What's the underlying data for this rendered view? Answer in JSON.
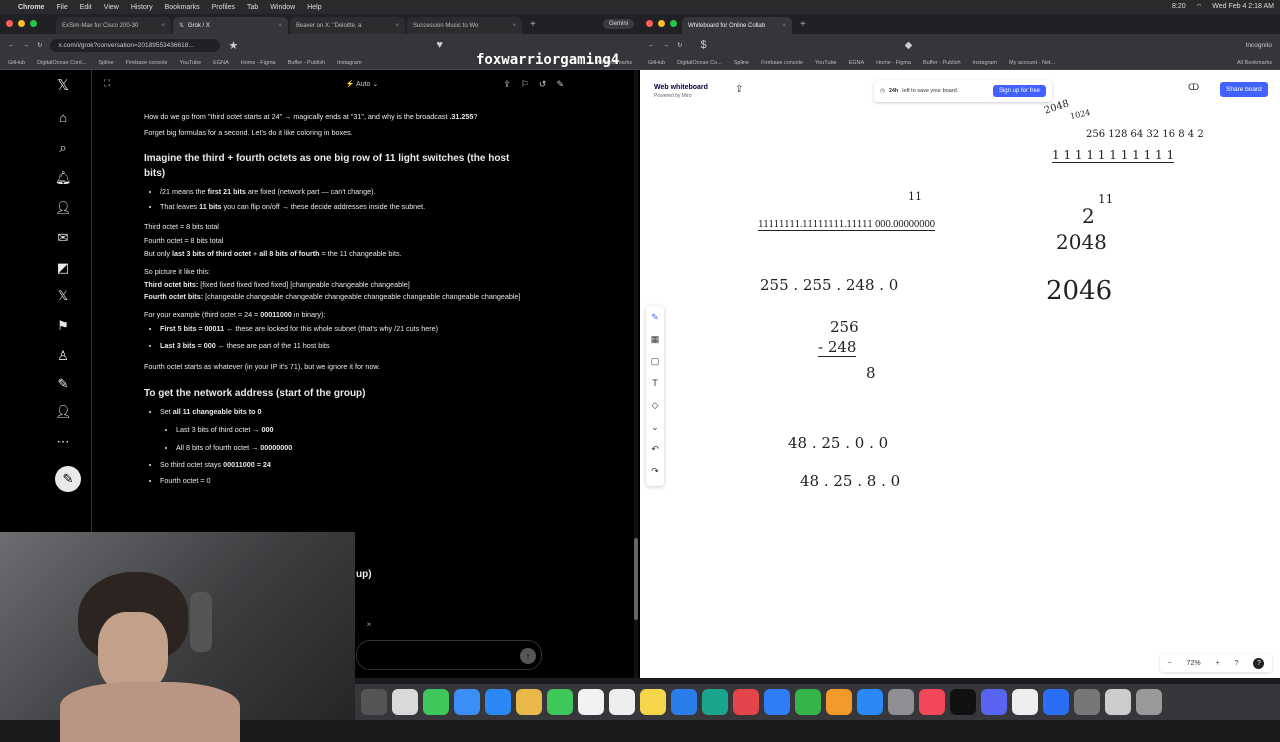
{
  "menubar": {
    "app": "Chrome",
    "items": [
      "File",
      "Edit",
      "View",
      "History",
      "Bookmarks",
      "Profiles",
      "Tab",
      "Window",
      "Help"
    ],
    "clock": "Wed Feb 4  2:18 AM",
    "extra": "8:20"
  },
  "left_window": {
    "tabs": [
      {
        "label": "ExSim-Max for Cisco 200-30"
      },
      {
        "label": "Grok / X"
      },
      {
        "label": "Beaver on X: \"Deloitte, a"
      },
      {
        "label": "Succession Music to Wo"
      }
    ],
    "gemini": "Gemini",
    "url": "x.com/i/grok?conversation=20189553436618...",
    "overlay_name": "foxwarriorgaming4",
    "bookmarks": [
      "GitHub",
      "DigitalOcean Cont...",
      "Spline",
      "Firebase console",
      "YouTube",
      "EGNA",
      "Home - Figma",
      "Buffer - Publish",
      "Instagram"
    ],
    "all_bookmarks": "All Bookmarks",
    "mode": "Auto"
  },
  "right_window": {
    "tabs": [
      {
        "label": "Whiteboard for Online Collab"
      }
    ],
    "incognito": "Incognito",
    "bookmarks": [
      "GitHub",
      "DigitalOcean Co...",
      "Spline",
      "Firebase console",
      "YouTube",
      "EGNA",
      "Home - Figma",
      "Buffer - Publish",
      "Instagram",
      "My account - Net..."
    ],
    "all_bookmarks": "All Bookmarks",
    "board_title": "Web whiteboard",
    "board_sub": "Powered by Miro",
    "banner_text_bold": "24h",
    "banner_text": "left to save your board.",
    "signup": "Sign up for free",
    "share": "Share board",
    "zoom": "72%"
  },
  "chat": {
    "intro1_a": "How do we go from \"third octet starts at 24\" → magically ends at \"31\", and why is the broadcast ",
    "intro1_b": ".31.255",
    "intro1_c": "?",
    "intro2": "Forget big formulas for a second. Let's do it like coloring in boxes.",
    "heading1": "Imagine the third + fourth octets as one big row of 11 light switches (the host bits)",
    "b1_a": "/21 means the ",
    "b1_b": "first 21 bits",
    "b1_c": " are fixed (network part — can't change).",
    "b2_a": "That leaves ",
    "b2_b": "11 bits",
    "b2_c": " you can flip on/off → these decide addresses inside the subnet.",
    "l1": "Third octet = 8 bits total",
    "l2": "Fourth octet = 8 bits total",
    "l3_a": "But only ",
    "l3_b": "last 3 bits of third octet",
    "l3_c": " + ",
    "l3_d": "all 8 bits of fourth",
    "l3_e": " = the 11 changeable bits.",
    "p1": "So picture it like this:",
    "p2_a": "Third octet bits:",
    "p2_b": " [fixed fixed fixed fixed fixed] [changeable changeable changeable]",
    "p3_a": "Fourth octet bits:",
    "p3_b": " [changeable changeable changeable changeable changeable changeable changeable changeable]",
    "ex_a": "For your example (third octet = 24 = ",
    "ex_b": "00011000",
    "ex_c": " in binary):",
    "e1_a": "First 5 bits = 00011",
    "e1_b": " ← these are locked for this whole subnet (that's why /21 cuts here)",
    "e2_a": "Last 3 bits = 000",
    "e2_b": " ← these are part of the 11 host bits",
    "p4": "Fourth octet starts as whatever (in your IP it's 71), but we ignore it for now.",
    "heading2": "To get the network address (start of the group)",
    "s1_a": "Set ",
    "s1_b": "all 11 changeable bits to 0",
    "s1a_a": "Last 3 bits of third octet → ",
    "s1a_b": "000",
    "s1b_a": "All 8 bits of fourth octet → ",
    "s1b_b": "00000000",
    "s2_a": "So third octet stays ",
    "s2_b": "00011000 = 24",
    "s3": "Fourth octet = 0",
    "partial": "up)"
  },
  "whiteboard": {
    "n11": "11",
    "bits": "11111111.11111111.11111 000.00000000",
    "mask": "255 . 255 . 248 . 0",
    "sub1": "256",
    "sub2": "- 248",
    "sub3": "8",
    "ip1": "48 . 25 . 0 . 0",
    "ip2": "48 . 25 . 8 . 0",
    "powers_top": "2048",
    "powers_mid": "1024",
    "powers_row": "256 128 64 32 16 8 4 2",
    "ones_row": "1 1 1 1 1 1 1 1 1 1 1",
    "exp_base": "2",
    "exp_pow": "11",
    "val2048": "2048",
    "val2046": "2046"
  }
}
